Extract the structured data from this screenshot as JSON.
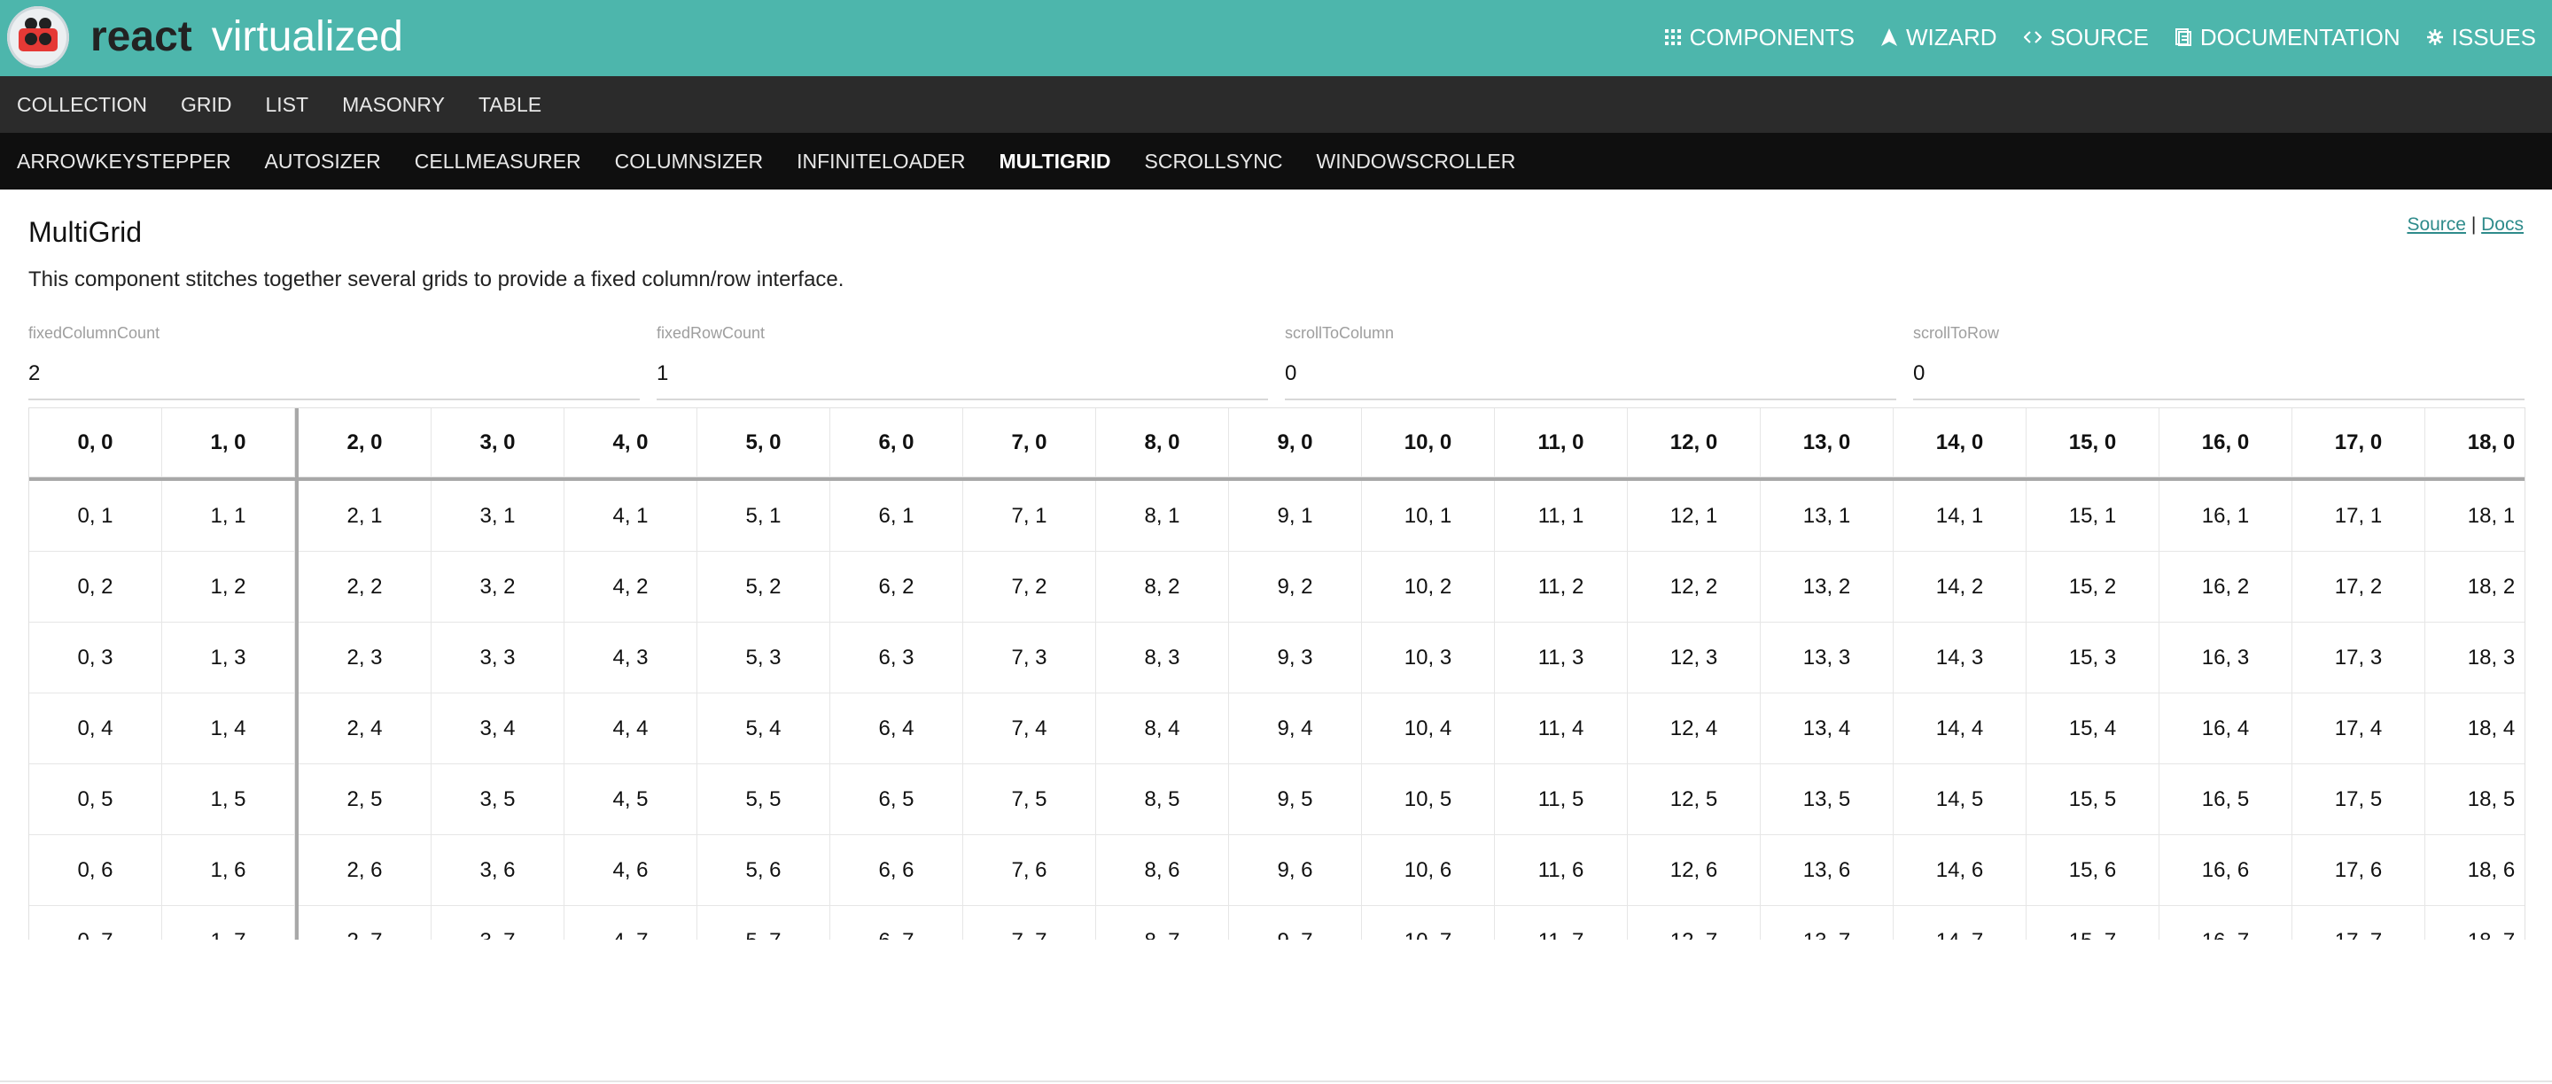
{
  "brand": {
    "part1": "react",
    "part2": "virtualized"
  },
  "topnav": [
    {
      "label": "COMPONENTS",
      "icon": "components-icon"
    },
    {
      "label": "WIZARD",
      "icon": "wizard-icon"
    },
    {
      "label": "SOURCE",
      "icon": "source-code-icon"
    },
    {
      "label": "DOCUMENTATION",
      "icon": "documentation-icon"
    },
    {
      "label": "ISSUES",
      "icon": "issues-icon"
    }
  ],
  "components_nav": [
    "COLLECTION",
    "GRID",
    "LIST",
    "MASONRY",
    "TABLE"
  ],
  "helpers_nav": [
    "ARROWKEYSTEPPER",
    "AUTOSIZER",
    "CELLMEASURER",
    "COLUMNSIZER",
    "INFINITELOADER",
    "MULTIGRID",
    "SCROLLSYNC",
    "WINDOWSCROLLER"
  ],
  "helpers_active": "MULTIGRID",
  "page": {
    "title": "MultiGrid",
    "description": "This component stitches together several grids to provide a fixed column/row interface.",
    "source_link": "Source",
    "separator": "|",
    "docs_link": "Docs"
  },
  "fields": [
    {
      "label": "fixedColumnCount",
      "value": "2"
    },
    {
      "label": "fixedRowCount",
      "value": "1"
    },
    {
      "label": "scrollToColumn",
      "value": "0"
    },
    {
      "label": "scrollToRow",
      "value": "0"
    }
  ],
  "grid": {
    "visible_columns": 19,
    "visible_rows": 8,
    "fixed_column_count": 2,
    "fixed_row_count": 1
  },
  "colors": {
    "header_bg": "#4db6ac",
    "nav2_bg": "#2b2b2b",
    "nav3_bg": "#0f0f0f",
    "link": "#2e8b8b"
  }
}
